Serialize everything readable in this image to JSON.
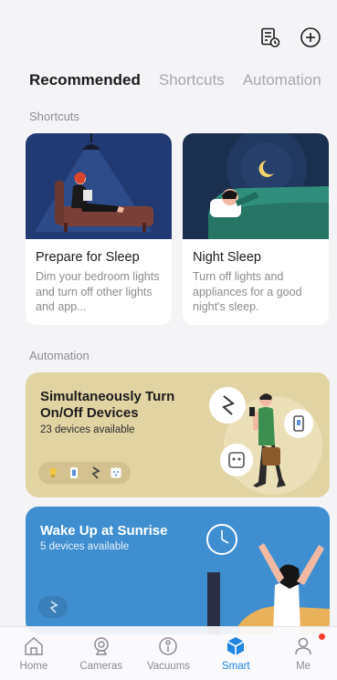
{
  "header": {
    "icons": [
      "log-icon",
      "add-icon"
    ]
  },
  "tabs": [
    {
      "label": "Recommended",
      "active": true
    },
    {
      "label": "Shortcuts",
      "active": false
    },
    {
      "label": "Automation",
      "active": false
    }
  ],
  "shortcuts": {
    "section_label": "Shortcuts",
    "cards": [
      {
        "title": "Prepare for Sleep",
        "description": "Dim your bedroom lights and turn off other lights and app...",
        "illustration": "woman-reading-on-sofa",
        "bg_color": "#223a73"
      },
      {
        "title": "Night Sleep",
        "description": "Turn off lights and appliances for a good night's sleep.",
        "illustration": "person-sleeping-moon",
        "bg_color": "#1b2f4f"
      }
    ]
  },
  "automation": {
    "section_label": "Automation",
    "cards": [
      {
        "title": "Simultaneously Turn On/Off Devices",
        "subtitle": "23 devices available",
        "bg_color": "#e2d3a2",
        "chips": [
          "bulb-icon",
          "switch-icon",
          "lightning-icon",
          "plug-icon"
        ],
        "illustration": "man-with-phone"
      },
      {
        "title": "Wake Up at Sunrise",
        "subtitle": "5 devices available",
        "bg_color": "#3f8fd0",
        "chips": [
          "lightning-icon"
        ],
        "illustration": "woman-stretching-clock"
      }
    ]
  },
  "nav": [
    {
      "label": "Home",
      "icon": "home-icon",
      "active": false
    },
    {
      "label": "Cameras",
      "icon": "camera-icon",
      "active": false
    },
    {
      "label": "Vacuums",
      "icon": "vacuum-icon",
      "active": false
    },
    {
      "label": "Smart",
      "icon": "smart-cube-icon",
      "active": true
    },
    {
      "label": "Me",
      "icon": "profile-icon",
      "active": false,
      "badge": true
    }
  ],
  "colors": {
    "accent": "#1f85e0",
    "badge": "#ff3b30"
  }
}
